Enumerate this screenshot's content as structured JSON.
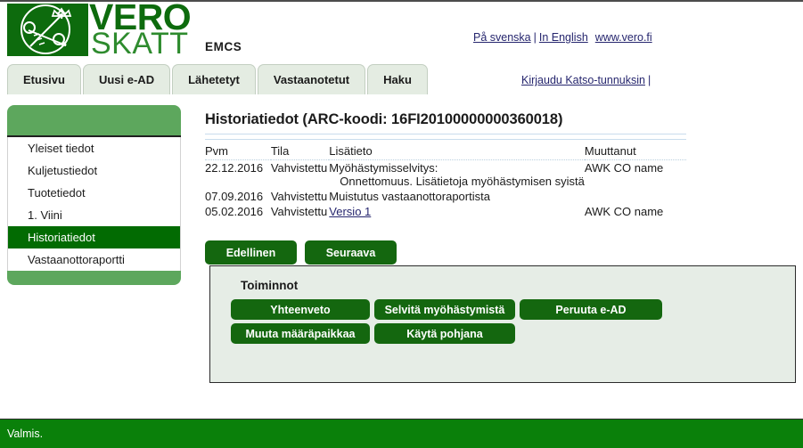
{
  "app": {
    "logo_primary": "VERO",
    "logo_secondary": "SKATT",
    "module_label": "EMCS"
  },
  "header": {
    "links": [
      {
        "label": "På svenska",
        "name": "swedish-link"
      },
      {
        "label": "In English",
        "name": "english-link"
      },
      {
        "label": "www.vero.fi",
        "name": "vero-fi-link"
      }
    ],
    "separator": "|",
    "login_label": "Kirjaudu Katso-tunnuksin",
    "login_separator": "|"
  },
  "tabs": [
    {
      "label": "Etusivu"
    },
    {
      "label": "Uusi e-AD"
    },
    {
      "label": "Lähetetyt"
    },
    {
      "label": "Vastaanotetut"
    },
    {
      "label": "Haku"
    }
  ],
  "sidebar": {
    "items": [
      {
        "label": "Yleiset tiedot",
        "active": false
      },
      {
        "label": "Kuljetustiedot",
        "active": false
      },
      {
        "label": "Tuotetiedot",
        "active": false
      },
      {
        "label": "1. Viini",
        "active": false
      },
      {
        "label": "Historiatiedot",
        "active": true
      },
      {
        "label": "Vastaanottoraportti",
        "active": false
      }
    ]
  },
  "main": {
    "title": "Historiatiedot (ARC-koodi: 16FI20100000000360018)",
    "table": {
      "columns": [
        "Pvm",
        "Tila",
        "Lisätieto",
        "Muuttanut"
      ],
      "rows": [
        {
          "pvm": "22.12.2016",
          "tila": "Vahvistettu",
          "lisatieto_line1": "Myöhästymisselvitys:",
          "lisatieto_line2": "Onnettomuus. Lisätietoja myöhästymisen syistä",
          "muuttanut": "AWK CO name"
        },
        {
          "pvm": "07.09.2016",
          "tila": "Vahvistettu",
          "lisatieto_line1": "Muistutus vastaanottoraportista",
          "lisatieto_line2": "",
          "muuttanut": ""
        },
        {
          "pvm": "05.02.2016",
          "tila": "Vahvistettu",
          "lisatieto_link": "Versio 1",
          "muuttanut": "AWK CO name"
        }
      ]
    }
  },
  "nav_buttons": [
    {
      "label": "Edellinen"
    },
    {
      "label": "Seuraava"
    }
  ],
  "actions": {
    "title": "Toiminnot",
    "row1": [
      {
        "label": "Yhteenveto"
      },
      {
        "label": "Selvitä myöhästymistä"
      },
      {
        "label": "Peruuta e-AD"
      }
    ],
    "row2": [
      {
        "label": "Muuta määräpaikkaa"
      },
      {
        "label": "Käytä pohjana"
      }
    ]
  },
  "status": {
    "text": "Valmis."
  },
  "colors": {
    "brand_green": "#0d6b0d",
    "button_green": "#14670f",
    "sidebar_band": "#5da75d",
    "sidebar_active": "#026b02",
    "status_green": "#0a800a",
    "panel_bg": "#e6ede6",
    "tab_bg": "#e4ece2",
    "link_blue": "#26266e"
  }
}
